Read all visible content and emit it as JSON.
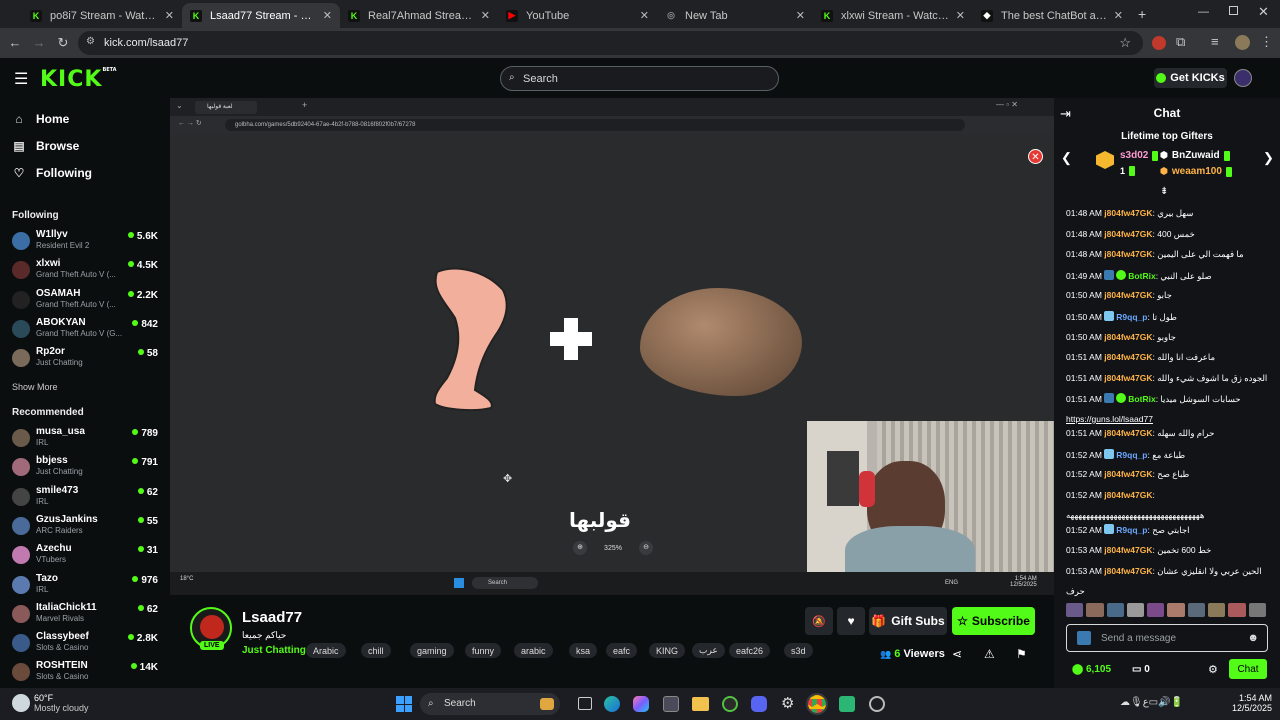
{
  "browser": {
    "tabs": [
      {
        "title": "po8i7 Stream - Watch Live on K",
        "active": false
      },
      {
        "title": "Lsaad77 Stream - Watch Live on",
        "active": true
      },
      {
        "title": "Real7Ahmad Stream - Watch Li",
        "active": false
      },
      {
        "title": "YouTube",
        "active": false
      },
      {
        "title": "New Tab",
        "active": false
      },
      {
        "title": "xlxwi Stream - Watch Live on Ki",
        "active": false
      },
      {
        "title": "The best ChatBot and Widgets",
        "active": false
      }
    ],
    "url": "kick.com/lsaad77"
  },
  "header": {
    "logo": "KICK",
    "logo_badge": "BETA",
    "search_placeholder": "Search",
    "get_kicks": "Get KICKs"
  },
  "sidebar": {
    "nav": [
      {
        "label": "Home",
        "icon": "home-icon"
      },
      {
        "label": "Browse",
        "icon": "browse-icon"
      },
      {
        "label": "Following",
        "icon": "heart-icon"
      }
    ],
    "following_title": "Following",
    "following": [
      {
        "name": "W1llyv",
        "game": "Resident Evil 2",
        "viewers": "5.6K",
        "color": "#3a6ea5"
      },
      {
        "name": "xlxwi",
        "game": "Grand Theft Auto V (...",
        "viewers": "4.5K",
        "color": "#5a2a2a"
      },
      {
        "name": "OSAMAH",
        "game": "Grand Theft Auto V (...",
        "viewers": "2.2K",
        "color": "#222"
      },
      {
        "name": "ABOKYAN",
        "game": "Grand Theft Auto V (G...",
        "viewers": "842",
        "color": "#2a4a5a"
      },
      {
        "name": "Rp2or",
        "game": "Just Chatting",
        "viewers": "58",
        "color": "#7a6a5a"
      }
    ],
    "show_more": "Show More",
    "recommended_title": "Recommended",
    "recommended": [
      {
        "name": "musa_usa",
        "game": "IRL",
        "viewers": "789",
        "color": "#6a5a4a"
      },
      {
        "name": "bbjess",
        "game": "Just Chatting",
        "viewers": "791",
        "color": "#a06a7a"
      },
      {
        "name": "smile473",
        "game": "IRL",
        "viewers": "62",
        "color": "#444"
      },
      {
        "name": "GzusJankins",
        "game": "ARC Raiders",
        "viewers": "55",
        "color": "#4a6a9a"
      },
      {
        "name": "Azechu",
        "game": "VTubers",
        "viewers": "31",
        "color": "#c07ab0"
      },
      {
        "name": "Tazo",
        "game": "IRL",
        "viewers": "976",
        "color": "#5a7ab0"
      },
      {
        "name": "ItaliaChick11",
        "game": "Marvel Rivals",
        "viewers": "62",
        "color": "#8a5a5a"
      },
      {
        "name": "Classybeef",
        "game": "Slots & Casino",
        "viewers": "2.8K",
        "color": "#3a5a8a"
      },
      {
        "name": "ROSHTEIN",
        "game": "Slots & Casino",
        "viewers": "14K",
        "color": "#6a4a3a"
      }
    ]
  },
  "video": {
    "inner_url": "golbha.com/games/5db92404-67ae-4b2f-b788-0816f802f0b7/67278",
    "inner_tab": "لعبة قولبها",
    "game_logo": "قولبها",
    "zoom": "325%",
    "inner_search": "Search",
    "inner_weather": "18°C",
    "inner_lang": "ENG",
    "inner_time": "1:54 AM",
    "inner_date": "12/5/2025"
  },
  "stream": {
    "streamer": "Lsaad77",
    "title": "حياكم جميعا",
    "category": "Just Chatting",
    "live_badge": "LIVE",
    "tags": [
      "Arabic",
      "chill",
      "gaming",
      "funny",
      "arabic",
      "ksa",
      "eafc",
      "KING",
      "عرب",
      "eafc26",
      "s3d"
    ],
    "gift_subs": "Gift Subs",
    "subscribe": "Subscribe",
    "viewers": "6",
    "viewers_label": "Viewers"
  },
  "chat": {
    "title": "Chat",
    "gifters_title": "Lifetime top Gifters",
    "gifters": [
      {
        "name": "s3d02",
        "count": "1",
        "color": "#ff9ad1"
      },
      {
        "name": "BnZuwaid",
        "count": "1",
        "color": "#fff"
      },
      {
        "name": "weaam100",
        "count": "1",
        "color": "#ffb347"
      }
    ],
    "messages": [
      {
        "time": "01:48 AM",
        "user": "j804fw47GK",
        "text": "سهل بيري",
        "color": "#ffb347"
      },
      {
        "time": "01:48 AM",
        "user": "j804fw47GK",
        "text": "خمس 400",
        "color": "#ffb347"
      },
      {
        "time": "01:48 AM",
        "user": "j804fw47GK",
        "text": "ما فهمت الي على اليمين",
        "color": "#ffb347"
      },
      {
        "time": "01:49 AM",
        "user": "BotRix",
        "text": "صلو على النبي",
        "color": "#53fc18",
        "bot": true
      },
      {
        "time": "01:50 AM",
        "user": "j804fw47GK",
        "text": "جابو",
        "color": "#ffb347"
      },
      {
        "time": "01:50 AM",
        "user": "R9qq_p",
        "text": "طول تا",
        "color": "#6aa7ff",
        "badge": true
      },
      {
        "time": "01:50 AM",
        "user": "j804fw47GK",
        "text": "جاوبو",
        "color": "#ffb347"
      },
      {
        "time": "01:51 AM",
        "user": "j804fw47GK",
        "text": "ماعرفت انا والله",
        "color": "#ffb347"
      },
      {
        "time": "01:51 AM",
        "user": "j804fw47GK",
        "text": "الجوده زق ما اشوف شيء والله",
        "color": "#ffb347"
      },
      {
        "time": "01:51 AM",
        "user": "BotRix",
        "text": "حسابات السوشل ميديا",
        "color": "#53fc18",
        "bot": true
      },
      {
        "time": "",
        "user": "",
        "text": "https://guns.lol/lsaad77",
        "color": "#fff",
        "link": true
      },
      {
        "time": "01:51 AM",
        "user": "j804fw47GK",
        "text": "حرام والله سهله",
        "color": "#ffb347"
      },
      {
        "time": "01:52 AM",
        "user": "R9qq_p",
        "text": "طباعة مع",
        "color": "#6aa7ff",
        "badge": true
      },
      {
        "time": "01:52 AM",
        "user": "j804fw47GK",
        "text": "طباع صح",
        "color": "#ffb347"
      },
      {
        "time": "01:52 AM",
        "user": "j804fw47GK",
        "text": "",
        "color": "#ffb347"
      },
      {
        "time": "",
        "user": "",
        "text": "ههههههههههههههههههههههههههههههههههه",
        "color": "#fff"
      },
      {
        "time": "01:52 AM",
        "user": "R9qq_p",
        "text": "اجابتي صح",
        "color": "#6aa7ff",
        "badge": true
      },
      {
        "time": "01:53 AM",
        "user": "j804fw47GK",
        "text": "خط 600 تخمين",
        "color": "#ffb347"
      },
      {
        "time": "01:53 AM",
        "user": "j804fw47GK",
        "text": "الحين عربي ولا انقليزي عشان",
        "color": "#ffb347"
      },
      {
        "time": "",
        "user": "",
        "text": "حرف",
        "color": "#fff"
      }
    ],
    "input_placeholder": "Send a message",
    "kicks_balance": "6,105",
    "points": "0",
    "chat_button": "Chat"
  },
  "taskbar": {
    "temperature": "60°F",
    "weather": "Mostly cloudy",
    "search": "Search",
    "time": "1:54 AM",
    "date": "12/5/2025"
  }
}
